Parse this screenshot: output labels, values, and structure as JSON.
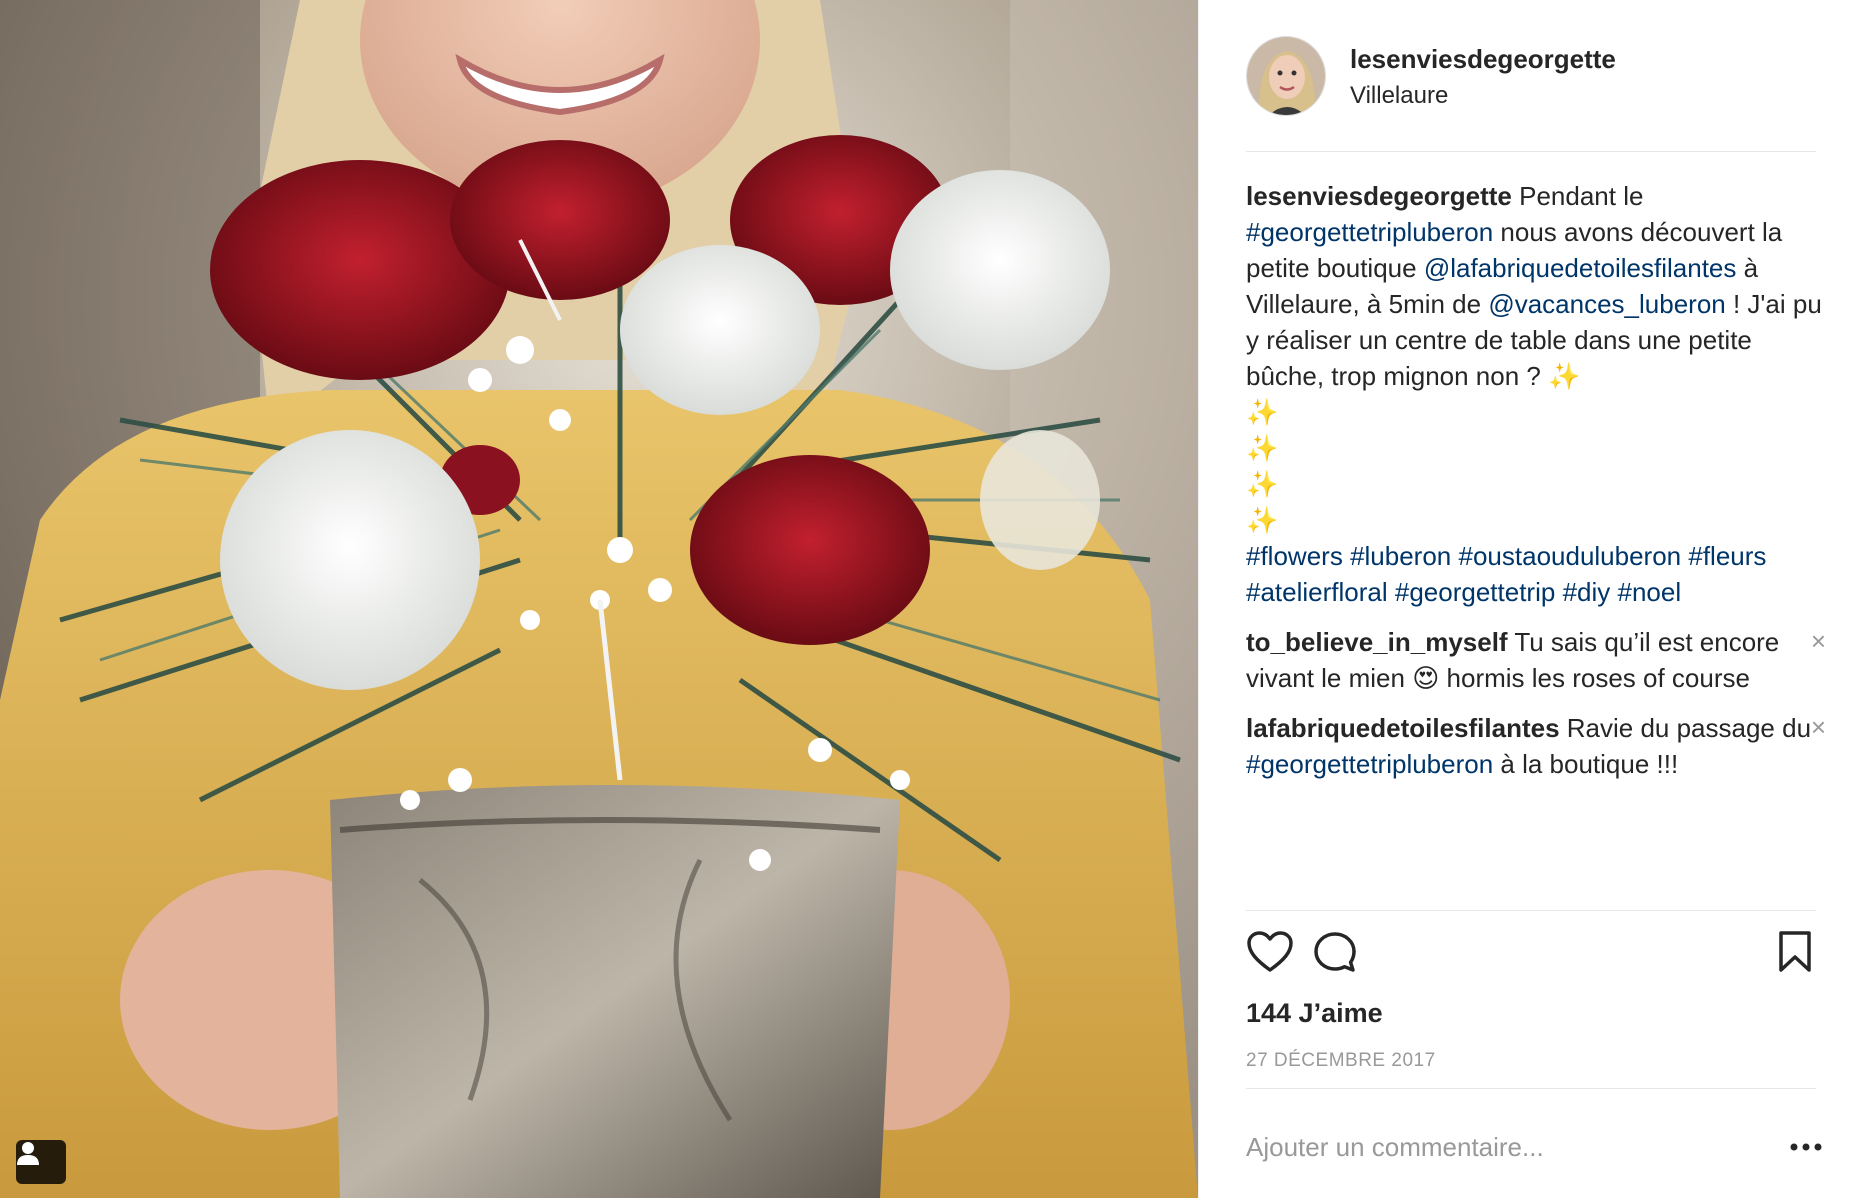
{
  "post": {
    "username": "lesenviesdegeorgette",
    "location": "Villelaure",
    "caption": {
      "username": "lesenviesdegeorgette",
      "part1": " Pendant le ",
      "hashtag1": "#georgettetripluberon",
      "part2": " nous avons découvert la petite boutique ",
      "mention1": "@lafabriquedetoilesfilantes",
      "part3": " à Villelaure, à 5min de ",
      "mention2": "@vacances_luberon",
      "part4": " ! J'ai pu y réaliser un centre de table dans une petite bûche, trop mignon non ? ",
      "sparkle": "✨",
      "tags": [
        "#flowers",
        "#luberon",
        "#oustaouduluberon",
        "#fleurs",
        "#atelierfloral",
        "#georgettetrip",
        "#diy",
        "#noel"
      ]
    },
    "comments": [
      {
        "username": "to_believe_in_myself",
        "text_a": " Tu sais qu’il est encore vivant le mien ",
        "emoji": "😍",
        "text_b": " hormis les roses of course",
        "close": "×"
      },
      {
        "username": "lafabriquedetoilesfilantes",
        "text_a": " Ravie du passage du ",
        "hashtag": "#georgettetripluberon",
        "text_b": " à la boutique !!!",
        "close": "×"
      }
    ],
    "likes": "144 J’aime",
    "date": "27 DÉCEMBRE 2017",
    "comment_placeholder": "Ajouter un commentaire...",
    "icons": {
      "like": "heart-icon",
      "comment": "comment-bubble-icon",
      "save": "bookmark-icon",
      "more": "more-options-icon",
      "tag": "user-tag-icon"
    },
    "colors": {
      "link": "#003569",
      "text": "#262626",
      "muted": "#999999",
      "sparkle": "#f0b400"
    }
  }
}
